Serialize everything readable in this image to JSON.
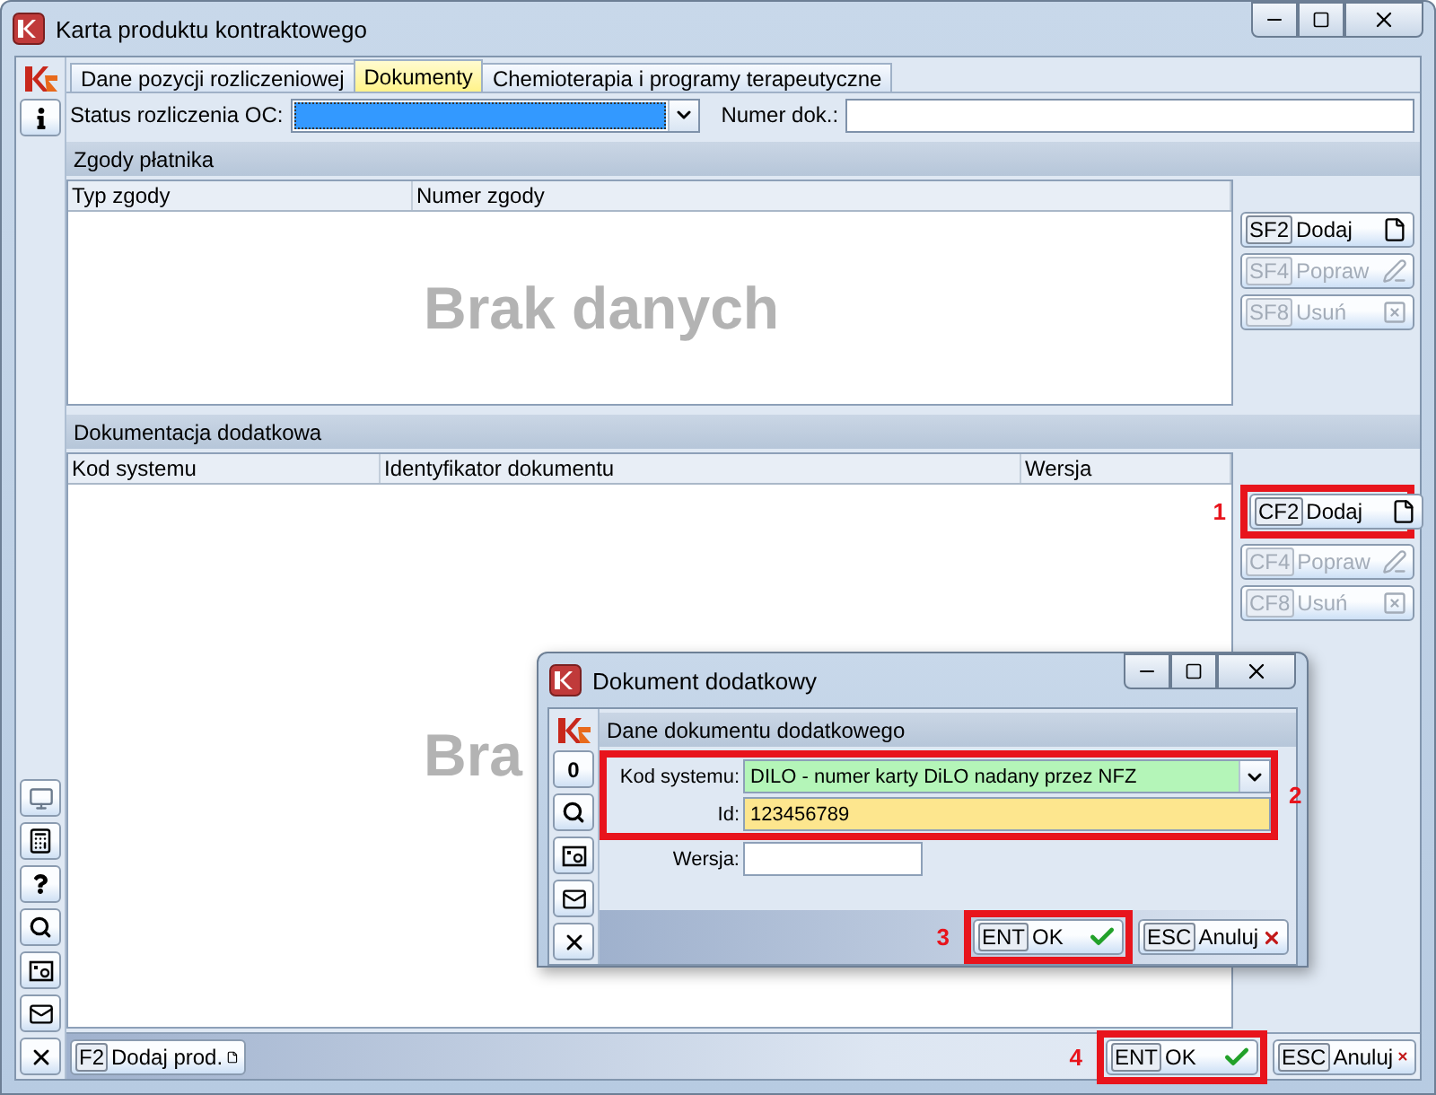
{
  "window": {
    "title": "Karta produktu kontraktowego"
  },
  "rail": {
    "top": [
      {
        "kind": "info"
      }
    ],
    "bottom": [
      {
        "kind": "monitor"
      },
      {
        "kind": "calculator"
      },
      {
        "kind": "help"
      },
      {
        "kind": "search"
      },
      {
        "kind": "photo"
      },
      {
        "kind": "mail"
      },
      {
        "kind": "close"
      }
    ]
  },
  "tabs": [
    {
      "label": "Dane pozycji rozliczeniowej",
      "selected": false
    },
    {
      "label": "Dokumenty",
      "selected": true
    },
    {
      "label": "Chemioterapia i programy terapeutyczne",
      "selected": false
    }
  ],
  "filters": {
    "status_label": "Status rozliczenia OC:",
    "number_label": "Numer dok.:"
  },
  "sections": [
    {
      "title": "Zgody płatnika",
      "columns": [
        "Typ zgody",
        "Numer zgody"
      ],
      "empty_text": "Brak danych",
      "buttons": [
        {
          "key": "SF2",
          "label": "Dodaj",
          "kind": "add",
          "disabled": false
        },
        {
          "key": "SF4",
          "label": "Popraw",
          "kind": "edit",
          "disabled": true
        },
        {
          "key": "SF8",
          "label": "Usuń",
          "kind": "delete",
          "disabled": true
        }
      ]
    },
    {
      "title": "Dokumentacja dodatkowa",
      "columns": [
        "Kod systemu",
        "Identyfikator dokumentu",
        "Wersja"
      ],
      "empty_text": "Bra",
      "buttons": [
        {
          "key": "CF2",
          "label": "Dodaj",
          "kind": "add",
          "disabled": false,
          "callout": "1"
        },
        {
          "key": "CF4",
          "label": "Popraw",
          "kind": "edit",
          "disabled": true
        },
        {
          "key": "CF8",
          "label": "Usuń",
          "kind": "delete",
          "disabled": true
        }
      ]
    }
  ],
  "bottom_bar": {
    "left": [
      {
        "key": "F2",
        "label": "Dodaj prod.",
        "kind": "add"
      }
    ],
    "right": [
      {
        "key": "ENT",
        "label": "OK",
        "kind": "ok",
        "callout": "4"
      },
      {
        "key": "ESC",
        "label": "Anuluj",
        "kind": "cancel"
      }
    ]
  },
  "dialog": {
    "title": "Dokument dodatkowy",
    "rail": [
      {
        "kind": "counter",
        "text": "0"
      },
      {
        "kind": "search"
      },
      {
        "kind": "photo"
      },
      {
        "kind": "mail"
      },
      {
        "kind": "close"
      }
    ],
    "section": "Dane dokumentu dodatkowego",
    "fields_callout": "2",
    "fields": [
      {
        "label": "Kod systemu:",
        "value": "DILO - numer karty DiLO nadany przez NFZ",
        "kind": "dropdown",
        "color": "#b4f5b8",
        "highlighted": true
      },
      {
        "label": "Id:",
        "value": "123456789",
        "kind": "text",
        "color": "#fde68e",
        "highlighted": true
      },
      {
        "label": "Wersja:",
        "kind": "short",
        "color": "#ffffff",
        "highlighted": false
      }
    ],
    "buttons": [
      {
        "key": "ENT",
        "label": "OK",
        "kind": "ok",
        "callout": "3"
      },
      {
        "key": "ESC",
        "label": "Anuluj",
        "kind": "cancel"
      }
    ]
  }
}
